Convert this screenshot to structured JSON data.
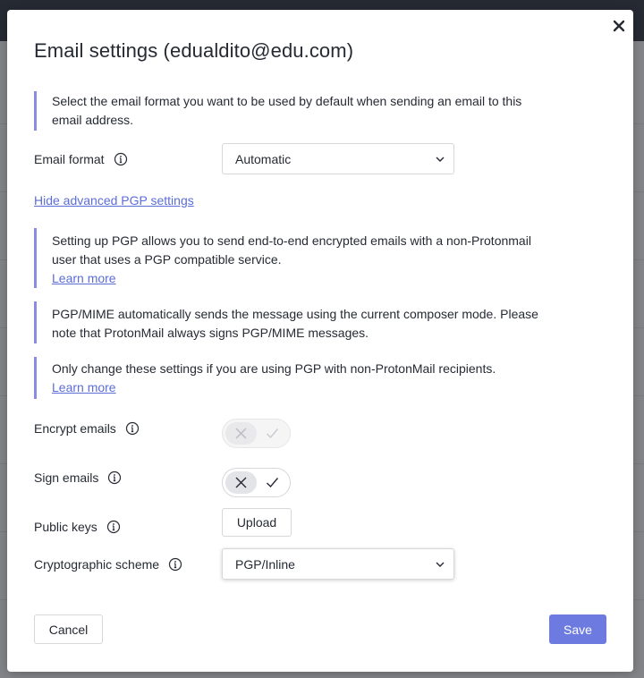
{
  "modal": {
    "title": "Email settings (edualdito@edu.com)",
    "format_info": "Select the email format you want to be used by default when sending an email to this email address.",
    "email_format": {
      "label": "Email format",
      "value": "Automatic"
    },
    "advanced_link": "Hide advanced PGP settings",
    "pgp_info_1": "Setting up PGP allows you to send end-to-end encrypted emails with a non-Protonmail user that uses a PGP compatible service.",
    "pgp_info_1_link": "Learn more",
    "pgp_info_2": "PGP/MIME automatically sends the message using the current composer mode. Please note that ProtonMail always signs PGP/MIME messages.",
    "pgp_info_3": "Only change these settings if you are using PGP with non-ProtonMail recipients.",
    "pgp_info_3_link": "Learn more",
    "encrypt": {
      "label": "Encrypt emails",
      "state": "off",
      "disabled": true
    },
    "sign": {
      "label": "Sign emails",
      "state": "off",
      "disabled": false
    },
    "public_keys": {
      "label": "Public keys",
      "button": "Upload"
    },
    "scheme": {
      "label": "Cryptographic scheme",
      "value": "PGP/Inline"
    },
    "cancel_label": "Cancel",
    "save_label": "Save"
  },
  "icons": {
    "close": "close-icon",
    "info": "info-icon",
    "chevron": "chevron-down-icon",
    "toggle_off": "cross-icon",
    "toggle_on": "checkmark-icon"
  },
  "colors": {
    "accent": "#6d7be0",
    "link": "#5c6dd6",
    "info_border": "#8b8ce0",
    "topbar": "#262a33"
  }
}
